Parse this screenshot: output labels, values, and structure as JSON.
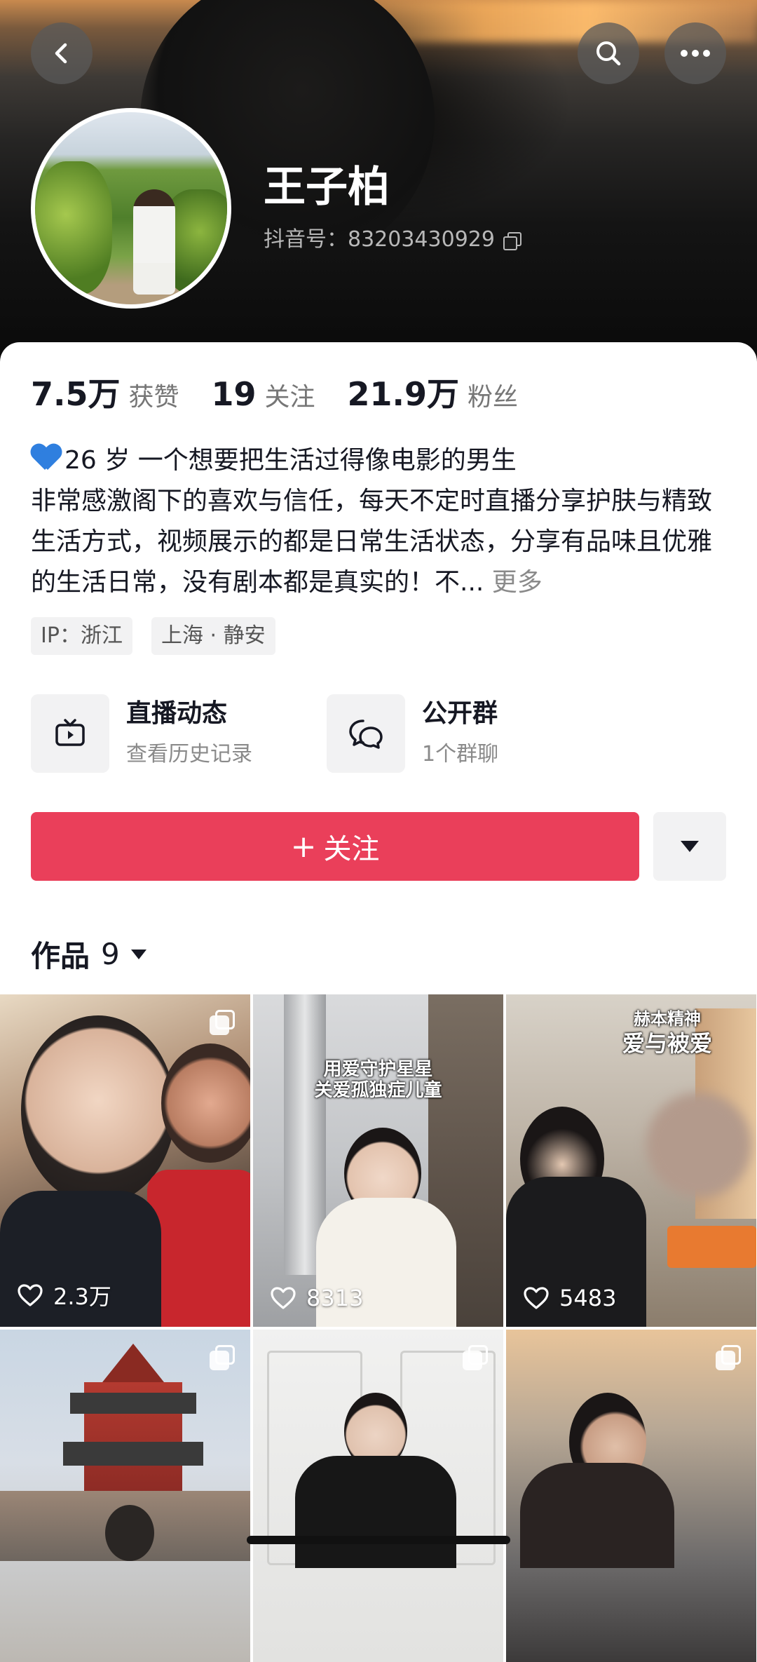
{
  "profile": {
    "name": "王子柏",
    "douyin_id": "抖音号：83203430929"
  },
  "stats": [
    {
      "value": "7.5万",
      "label": "获赞"
    },
    {
      "value": "19",
      "label": "关注"
    },
    {
      "value": "21.9万",
      "label": "粉丝"
    }
  ],
  "bio": {
    "line1": "26 岁 一个想要把生活过得像电影的男生",
    "line2": "非常感激阁下的喜欢与信任，每天不定时直播分享护肤与精致生活方式，视频展示的都是日常生活状态，分享有品味且优雅的生活日常，没有剧本都是真实的！不...",
    "more": "更多",
    "emoji": "blue-heart"
  },
  "tags": [
    "IP：浙江",
    "上海 · 静安"
  ],
  "entries": [
    {
      "title": "直播动态",
      "subtitle": "查看历史记录",
      "icon": "tv-icon"
    },
    {
      "title": "公开群",
      "subtitle": "1个群聊",
      "icon": "chat-bubbles-icon"
    }
  ],
  "follow": {
    "label": "关注",
    "plus": "+"
  },
  "works": {
    "title": "作品",
    "count": "9"
  },
  "videos": [
    {
      "likes": "2.3万",
      "multi": true,
      "overlay": []
    },
    {
      "likes": "8313",
      "multi": false,
      "overlay": [
        "用爱守护星星",
        "关爱孤独症儿童"
      ]
    },
    {
      "likes": "5483",
      "multi": false,
      "overlay": [
        "赫本精神",
        "爱与被爱"
      ]
    },
    {
      "likes": "",
      "multi": true,
      "overlay": []
    },
    {
      "likes": "",
      "multi": true,
      "overlay": []
    },
    {
      "likes": "",
      "multi": true,
      "overlay": []
    }
  ],
  "colors": {
    "accent": "#ea3f5a",
    "text_primary": "#161823",
    "text_secondary": "#8a8a8a",
    "chip_bg": "#f2f2f3"
  }
}
